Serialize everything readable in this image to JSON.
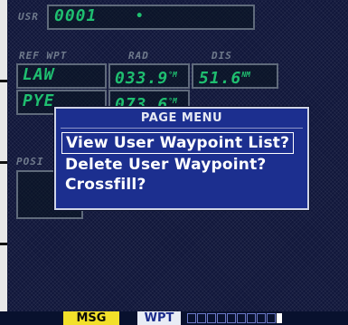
{
  "header": {
    "usr_label": "USR",
    "waypoint_id": "0001",
    "waypoint_symbol": "•"
  },
  "columns": {
    "ref_wpt": "REF WPT",
    "rad": "RAD",
    "dis": "DIS"
  },
  "ref_rows": [
    {
      "wpt": "LAW",
      "rad": "033.9",
      "rad_unit": "°M",
      "dis": "51.6",
      "dis_unit": "NM"
    },
    {
      "wpt": "PYE",
      "rad": "073.6",
      "rad_unit": "°M"
    }
  ],
  "position_label": "POSI",
  "page_menu": {
    "title": "PAGE MENU",
    "items": [
      "View User Waypoint List?",
      "Delete User Waypoint?",
      "Crossfill?"
    ],
    "selected_index": 0
  },
  "status_bar": {
    "msg": "MSG",
    "mode": "WPT",
    "page_count": 10,
    "active_page": 10
  },
  "colors": {
    "background": "#10163a",
    "field_text": "#1fbf70",
    "menu_bg": "#1c2f8f",
    "msg_bg": "#f2e02a"
  }
}
